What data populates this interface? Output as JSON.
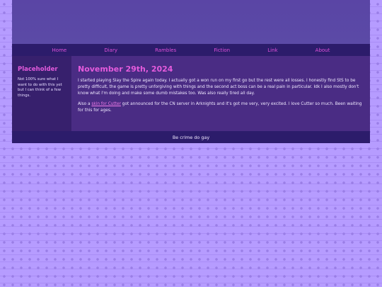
{
  "nav": {
    "items": [
      "Home",
      "Diary",
      "Rambles",
      "Fiction",
      "Link",
      "About"
    ]
  },
  "sidebar": {
    "title": "Placeholder",
    "text": "Not 100% sure what I want to do with this yet but I can think of a few things."
  },
  "post": {
    "date": "November 29th, 2024",
    "p1": "I started playing Slay the Spire again today. I actually got a won run on my first go but the rest were all losses. I honestly find StS to be pretty difficult, the game is pretty unforgiving with things and the second act boss can be a real pain in particular. Idk I also mostly don't know what I'm doing and make some dumb mistakes too. Was also really tired all day.",
    "p2_before": "Also a ",
    "p2_link": "skin for Cutter",
    "p2_after": " got announced for the CN server in Arknights and it's got me very, very excited. I love Cutter so much. Been waiting for this for ages."
  },
  "footer": {
    "text": "Be crime do gay"
  },
  "colors": {
    "accent": "#e45bdc",
    "nav_bg": "#2c1c6b",
    "main_bg": "#4a2c84",
    "sidebar_bg": "#37206d",
    "header_bg": "#5a45a5",
    "page_bg": "#b69cff"
  }
}
